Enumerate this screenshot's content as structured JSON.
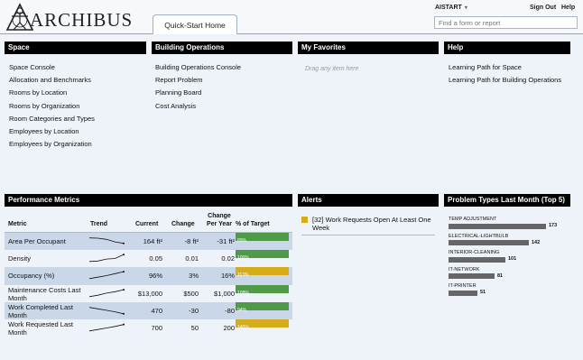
{
  "header": {
    "logo_text": "ARCHIBUS",
    "tab_label": "Quick-Start Home",
    "user_label": "AISTART",
    "sign_out_label": "Sign Out",
    "help_label": "Help",
    "search_placeholder": "Find a form or report"
  },
  "panels": {
    "space": {
      "title": "Space",
      "items": [
        "Space Console",
        "Allocation and Benchmarks",
        "Rooms by Location",
        "Rooms by Organization",
        "Room Categories and Types",
        "Employees by Location",
        "Employees by Organization"
      ]
    },
    "building_operations": {
      "title": "Building Operations",
      "items": [
        "Building Operations Console",
        "Report Problem",
        "Planning Board",
        "Cost Analysis"
      ]
    },
    "favorites": {
      "title": "My Favorites",
      "hint": "Drag any item here"
    },
    "help": {
      "title": "Help",
      "items": [
        "Learning Path for Space",
        "Learning Path for Building Operations"
      ]
    }
  },
  "performance": {
    "title": "Performance Metrics",
    "columns": {
      "metric": "Metric",
      "trend": "Trend",
      "current": "Current",
      "change": "Change",
      "change_per_year": "Change Per Year",
      "pct_target": "% of Target"
    },
    "rows": [
      {
        "metric": "Area Per Occupant",
        "current": "164 ft²",
        "change": "-8 ft²",
        "change_per_year": "-31 ft²",
        "pct": "89%",
        "pct_value": 89,
        "status_color": "#4f9a48",
        "trend": [
          0.85,
          0.82,
          0.7,
          0.45,
          0.3
        ]
      },
      {
        "metric": "Density",
        "current": "0.05",
        "change": "0.01",
        "change_per_year": "0.02",
        "pct": "100%",
        "pct_value": 100,
        "status_color": "#4f9a48",
        "trend": [
          0.2,
          0.25,
          0.45,
          0.5,
          0.9
        ]
      },
      {
        "metric": "Occupancy (%)",
        "current": "96%",
        "change": "3%",
        "change_per_year": "16%",
        "pct": "113%",
        "pct_value": 113,
        "status_color": "#d5ad1b",
        "trend": [
          0.2,
          0.35,
          0.5,
          0.7,
          0.9
        ]
      },
      {
        "metric": "Maintenance Costs Last Month",
        "current": "$13,000",
        "change": "$500",
        "change_per_year": "$1,000",
        "pct": "108%",
        "pct_value": 108,
        "status_color": "#4f9a48",
        "trend": [
          0.2,
          0.35,
          0.55,
          0.7,
          0.9
        ]
      },
      {
        "metric": "Work Completed Last Month",
        "current": "470",
        "change": "-30",
        "change_per_year": "-80",
        "pct": "94%",
        "pct_value": 94,
        "status_color": "#4f9a48",
        "trend": [
          0.85,
          0.7,
          0.55,
          0.4,
          0.2
        ]
      },
      {
        "metric": "Work Requested Last Month",
        "current": "700",
        "change": "50",
        "change_per_year": "200",
        "pct": "140%",
        "pct_value": 140,
        "status_color": "#d5ad1b",
        "trend": [
          0.2,
          0.35,
          0.5,
          0.65,
          0.85
        ]
      }
    ]
  },
  "alerts": {
    "title": "Alerts",
    "items": [
      {
        "text": "[32] Work Requests Open At Least One Week",
        "color": "#d5ad1b"
      }
    ]
  },
  "problem_types": {
    "title": "Problem Types Last Month (Top 5)",
    "items": [
      {
        "label": "TEMP ADJUSTMENT",
        "value": 173,
        "display": "173"
      },
      {
        "label": "ELECTRICAL-LIGHTBULB",
        "value": 142,
        "display": "142"
      },
      {
        "label": "INTERIOR-CLEANING",
        "value": 101,
        "display": "101"
      },
      {
        "label": "IT-NETWORK",
        "value": 81,
        "display": "81"
      },
      {
        "label": "IT-PRINTER",
        "value": 51,
        "display": "51"
      }
    ]
  }
}
